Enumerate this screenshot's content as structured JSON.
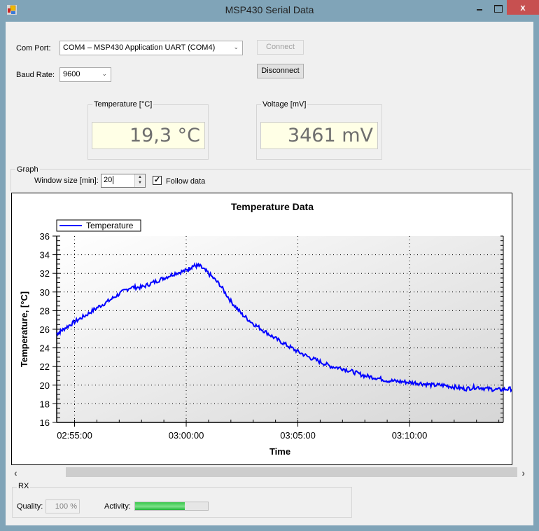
{
  "window": {
    "title": "MSP430 Serial Data",
    "icon": "app-icon",
    "controls": {
      "minimize": "minimize-icon",
      "maximize": "maximize-icon",
      "close_glyph": "x"
    }
  },
  "connection": {
    "com_port_label": "Com Port:",
    "com_port_value": "COM4 – MSP430 Application UART (COM4)",
    "baud_rate_label": "Baud Rate:",
    "baud_rate_value": "9600",
    "connect_label": "Connect",
    "connect_enabled": false,
    "disconnect_label": "Disconnect"
  },
  "readouts": {
    "temperature": {
      "title": "Temperature [°C]",
      "value": "19,3 °C"
    },
    "voltage": {
      "title": "Voltage [mV]",
      "value": "3461 mV"
    }
  },
  "graph": {
    "group_title": "Graph",
    "window_size_label": "Window size [min]:",
    "window_size_value": "20",
    "follow_data_label": "Follow data",
    "follow_data_checked": true
  },
  "chart_data": {
    "type": "line",
    "title": "Temperature Data",
    "xlabel": "Time",
    "ylabel": "Temperature, [°C]",
    "legend": {
      "entries": [
        "Temperature"
      ],
      "position": "top-left"
    },
    "series_color": "#0000ff",
    "ylim": [
      16,
      36
    ],
    "yticks": [
      "16",
      "18",
      "20",
      "22",
      "24",
      "26",
      "28",
      "30",
      "32",
      "34",
      "36"
    ],
    "xlim_minutes": [
      -0.8,
      19.2
    ],
    "xtick_minutes": [
      0,
      5,
      10,
      15
    ],
    "xtick_labels": [
      "02:55:00",
      "03:00:00",
      "03:05:00",
      "03:10:00"
    ],
    "grid": true,
    "series": [
      {
        "name": "Temperature",
        "x_minutes": [
          -0.8,
          -0.5,
          0,
          0.5,
          1,
          1.5,
          2,
          2.5,
          3,
          3.5,
          4,
          4.5,
          5,
          5.3,
          5.6,
          6,
          6.5,
          7,
          7.5,
          8,
          8.5,
          9,
          9.5,
          10,
          10.5,
          11,
          11.5,
          12,
          12.5,
          13,
          13.5,
          14,
          14.5,
          15,
          15.5,
          16,
          16.5,
          17,
          17.5,
          18,
          18.5,
          19,
          19.5,
          20,
          20.2
        ],
        "values": [
          25.5,
          26.0,
          26.8,
          27.5,
          28.3,
          29.0,
          29.8,
          30.5,
          30.5,
          31.0,
          31.5,
          32.0,
          32.3,
          32.8,
          32.8,
          32.0,
          30.8,
          29.0,
          27.6,
          26.6,
          25.8,
          25.0,
          24.3,
          23.6,
          23.0,
          22.5,
          22.0,
          21.8,
          21.4,
          21.0,
          20.8,
          20.5,
          20.4,
          20.3,
          20.2,
          20.0,
          20.0,
          19.8,
          19.6,
          19.8,
          19.6,
          19.5,
          19.6,
          19.5,
          19.5
        ]
      }
    ]
  },
  "rx": {
    "group_title": "RX",
    "quality_label": "Quality:",
    "quality_value": "100 %",
    "activity_label": "Activity:",
    "activity_fraction": 0.68
  }
}
